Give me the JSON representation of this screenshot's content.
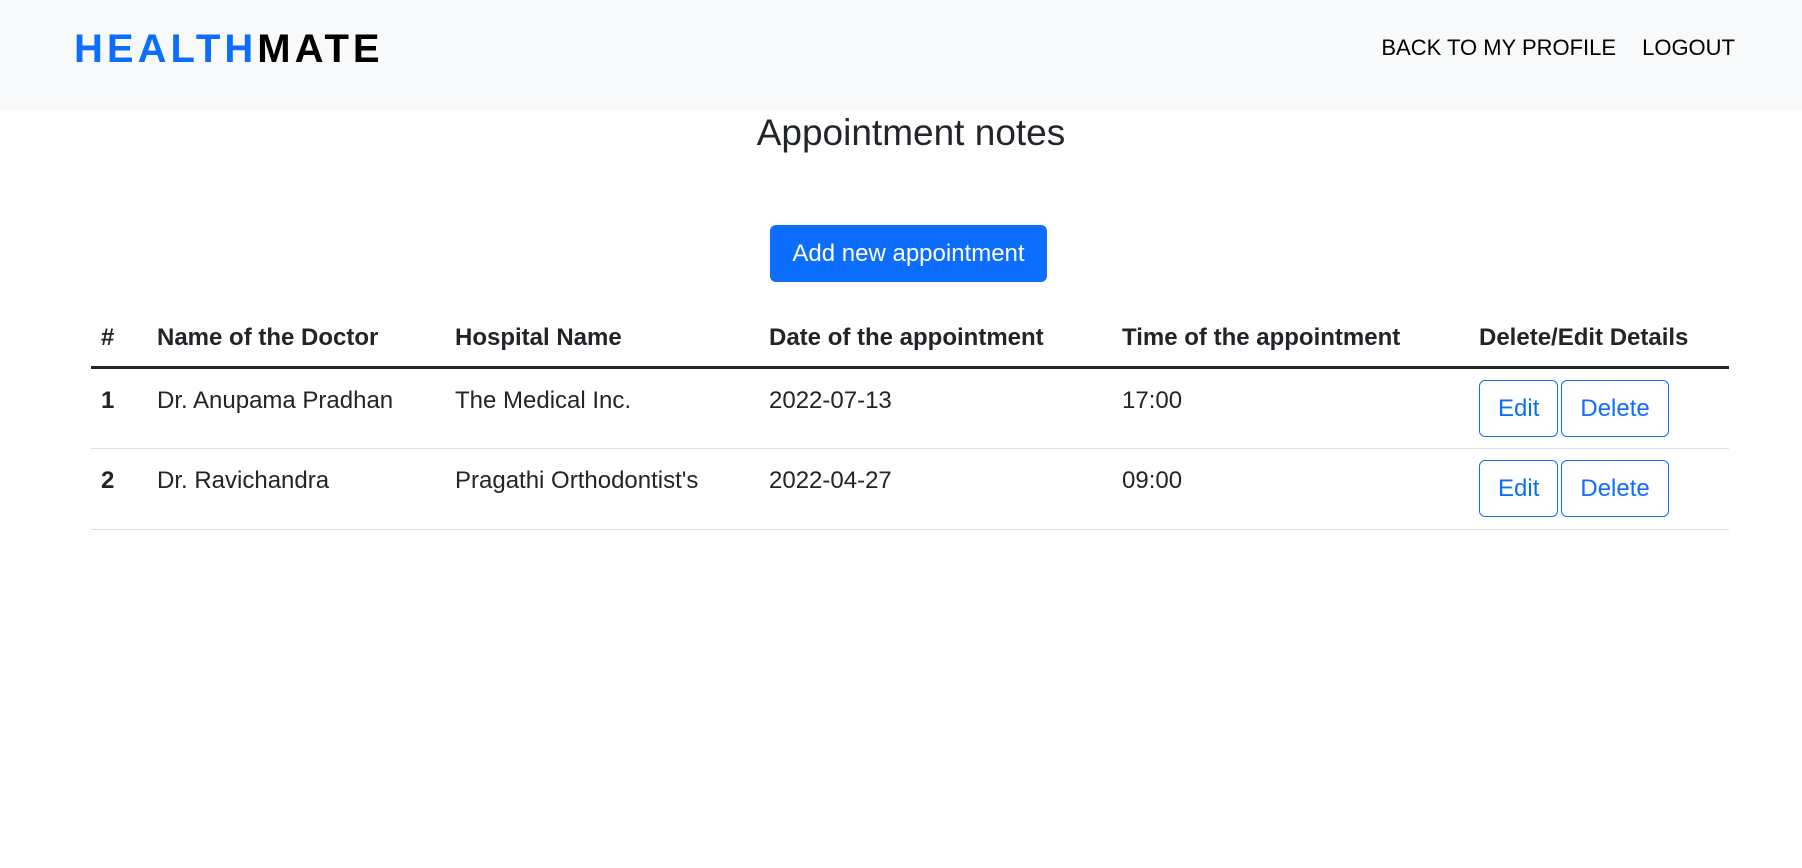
{
  "navbar": {
    "brand_part1": "HEALTH",
    "brand_part2": "MATE",
    "links": [
      {
        "label": "BACK TO MY PROFILE"
      },
      {
        "label": "LOGOUT"
      }
    ]
  },
  "main": {
    "title": "Appointment notes",
    "add_button_label": "Add new appointment"
  },
  "table": {
    "headers": [
      "#",
      "Name of the Doctor",
      "Hospital Name",
      "Date of the appointment",
      "Time of the appointment",
      "Delete/Edit Details"
    ],
    "rows": [
      {
        "num": "1",
        "doctor": "Dr. Anupama Pradhan",
        "hospital": "The Medical Inc.",
        "date": "2022-07-13",
        "time": "17:00",
        "edit_label": "Edit",
        "delete_label": "Delete"
      },
      {
        "num": "2",
        "doctor": "Dr. Ravichandra",
        "hospital": "Pragathi Orthodontist's",
        "date": "2022-04-27",
        "time": "09:00",
        "edit_label": "Edit",
        "delete_label": "Delete"
      }
    ]
  },
  "colors": {
    "accent": "#0d6efd",
    "navbar_bg": "#f8f9fa",
    "text": "#212529"
  }
}
